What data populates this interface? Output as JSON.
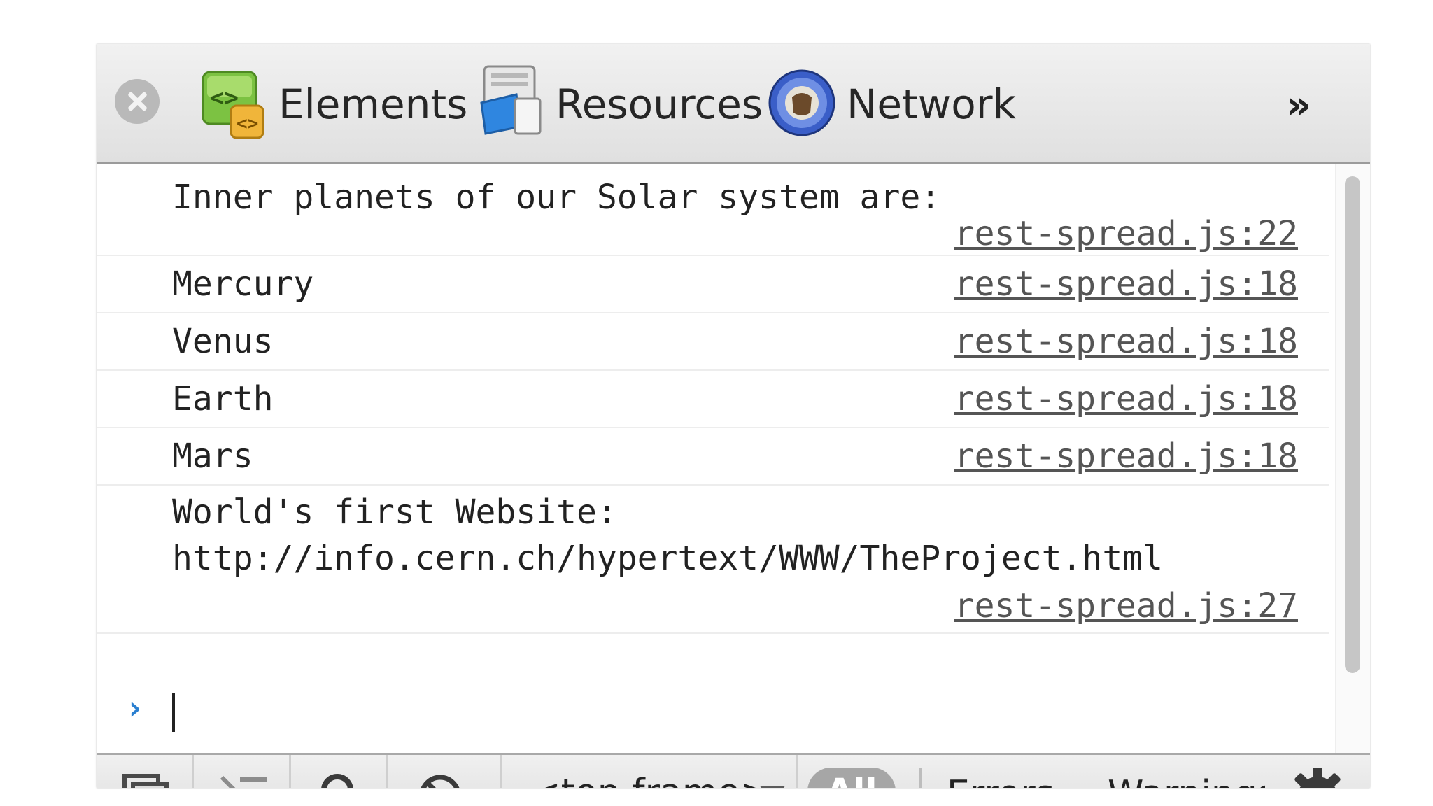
{
  "toolbar": {
    "tabs": [
      {
        "label": "Elements",
        "icon": "elements-icon"
      },
      {
        "label": "Resources",
        "icon": "resources-icon"
      },
      {
        "label": "Network",
        "icon": "network-icon"
      }
    ],
    "more": "»"
  },
  "console": {
    "messages": [
      {
        "text": "Inner planets of our Solar system are:",
        "source": "rest-spread.js:22"
      },
      {
        "text": "Mercury",
        "source": "rest-spread.js:18"
      },
      {
        "text": "Venus",
        "source": "rest-spread.js:18"
      },
      {
        "text": "Earth",
        "source": "rest-spread.js:18"
      },
      {
        "text": "Mars",
        "source": "rest-spread.js:18"
      },
      {
        "text": "World's first Website:",
        "text2": "http://info.cern.ch/hypertext/WWW/TheProject.html",
        "source": "rest-spread.js:27"
      }
    ],
    "prompt": "›",
    "input_value": ""
  },
  "statusbar": {
    "frame_select": "<top frame>",
    "filters": {
      "all": "All",
      "errors": "Errors",
      "warnings": "Warnings"
    }
  },
  "colors": {
    "prompt": "#2a7fd0",
    "all_pill": "#a6a6a6"
  }
}
